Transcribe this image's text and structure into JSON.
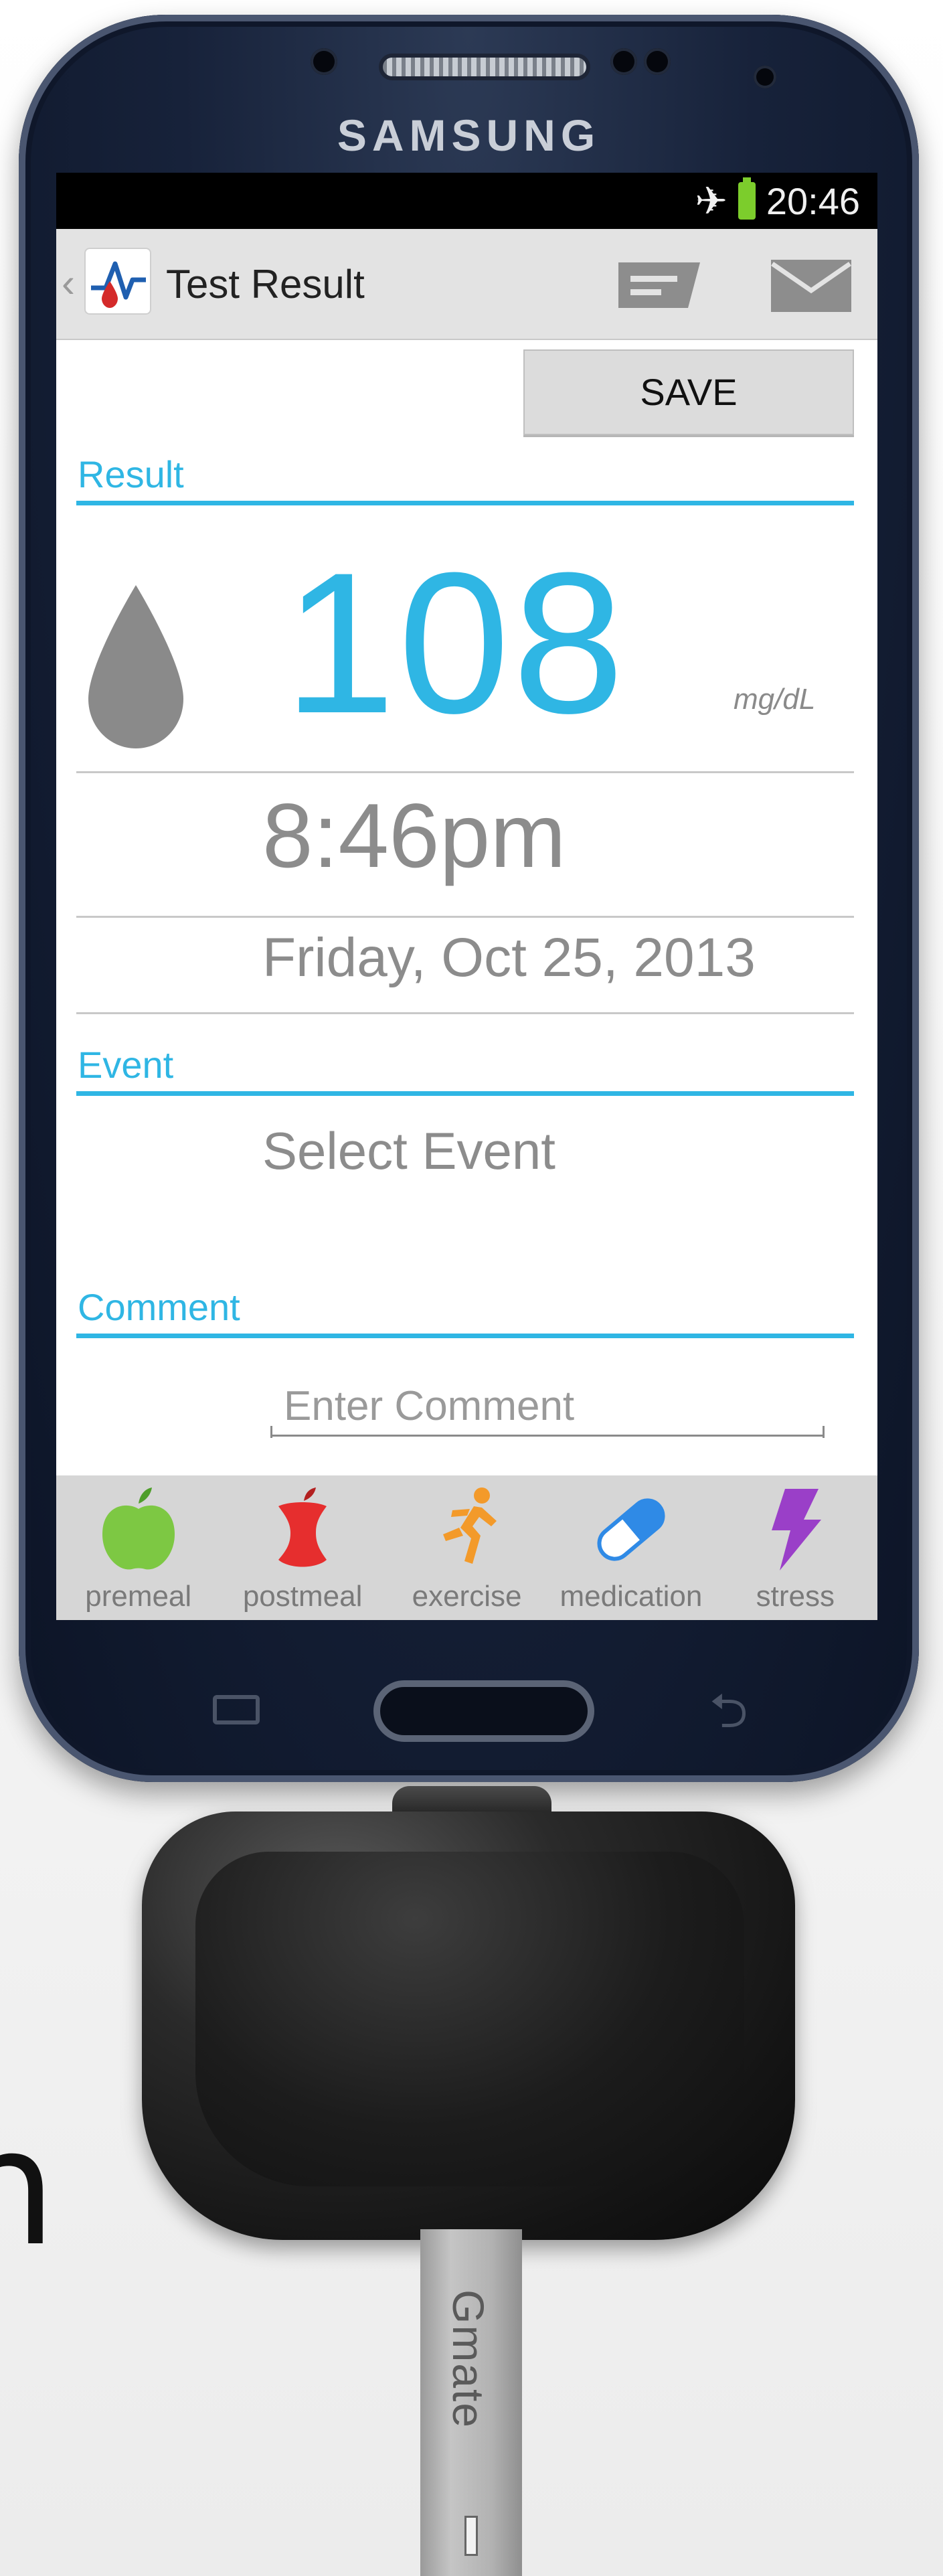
{
  "device": {
    "brand": "SAMSUNG",
    "dongle_label": "Gmate"
  },
  "status_bar": {
    "time": "20:46",
    "icons": [
      "airplane-mode-icon",
      "battery-icon"
    ]
  },
  "action_bar": {
    "title": "Test Result",
    "icons": [
      "back-chevron-icon",
      "app-logo-icon",
      "message-icon",
      "mail-icon"
    ]
  },
  "save_label": "SAVE",
  "result": {
    "section_label": "Result",
    "value": "108",
    "unit": "mg/dL",
    "time": "8:46pm",
    "date": "Friday, Oct 25, 2013"
  },
  "event": {
    "section_label": "Event",
    "placeholder": "Select Event"
  },
  "comment": {
    "section_label": "Comment",
    "placeholder": "Enter Comment"
  },
  "event_tabs": [
    {
      "label": "premeal",
      "icon": "apple-icon",
      "color": "#7dc843"
    },
    {
      "label": "postmeal",
      "icon": "eaten-apple-icon",
      "color": "#e62e2e"
    },
    {
      "label": "exercise",
      "icon": "runner-icon",
      "color": "#f39a2a"
    },
    {
      "label": "medication",
      "icon": "pill-icon",
      "color": "#2f8ae6"
    },
    {
      "label": "stress",
      "icon": "lightning-icon",
      "color": "#9a3fc8"
    }
  ],
  "partial_background_letter": "n",
  "colors": {
    "accent": "#2fb6e4",
    "phone_body": "#17223a"
  }
}
